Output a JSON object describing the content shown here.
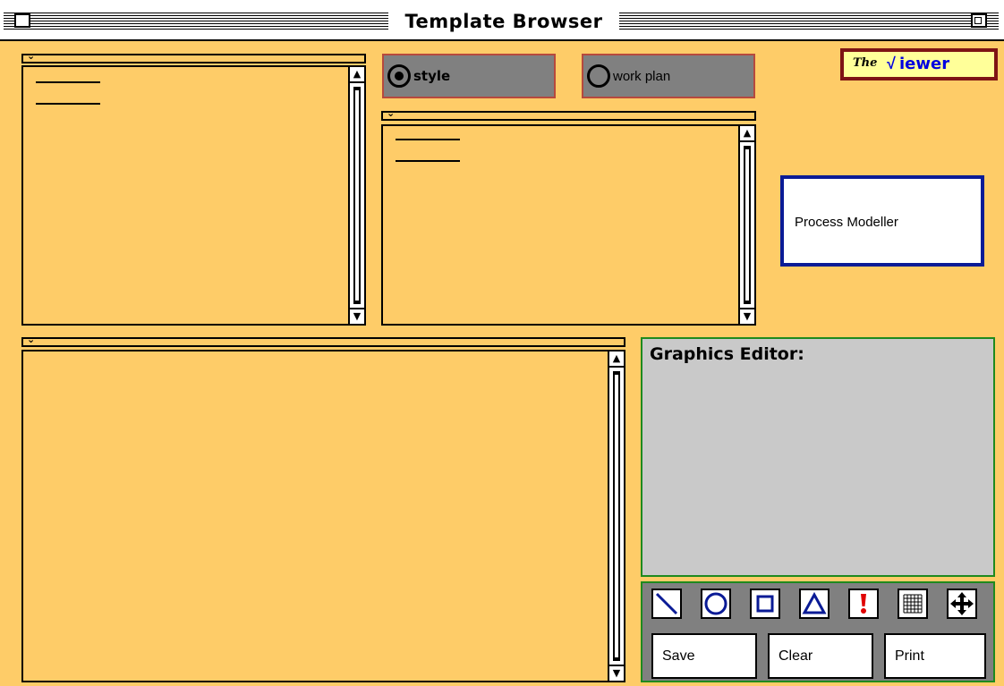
{
  "window": {
    "title": "Template Browser"
  },
  "radios": {
    "style": {
      "label": "style",
      "selected": true
    },
    "work_plan": {
      "label": "work plan",
      "selected": false
    }
  },
  "viewer": {
    "the": "The",
    "mark": "√",
    "word": "iewer"
  },
  "process_modeller": {
    "label": "Process Modeller"
  },
  "graphics_editor": {
    "title": "Graphics Editor:",
    "tools": [
      "line-tool-icon",
      "circle-tool-icon",
      "rectangle-tool-icon",
      "triangle-tool-icon",
      "exclamation-tool-icon",
      "grid-tool-icon",
      "move-tool-icon"
    ],
    "buttons": {
      "save": "Save",
      "clear": "Clear",
      "print": "Print"
    }
  },
  "colors": {
    "background": "#fecc68",
    "panel_gray": "#808080",
    "editor_gray": "#c9c9c9",
    "radio_border": "#b7493d",
    "viewer_border": "#7e1414",
    "viewer_bg": "#ffff99",
    "viewer_text": "#0000e0",
    "modeller_border": "#0a1b96",
    "editor_border": "#1e8a1e",
    "tool_icon_blue": "#0a1b96",
    "tool_icon_red": "#e00000"
  }
}
